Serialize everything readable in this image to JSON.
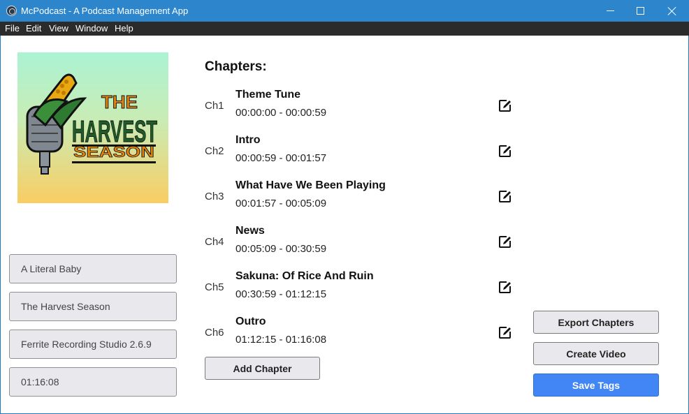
{
  "window": {
    "title": "McPodcast - A Podcast Management App"
  },
  "menu": [
    "File",
    "Edit",
    "View",
    "Window",
    "Help"
  ],
  "cover": {
    "line1": "THE",
    "line2": "HARVEST",
    "line3": "SEASON"
  },
  "metadata": {
    "artist": "A Literal Baby",
    "album": "The Harvest Season",
    "encoder": "Ferrite Recording Studio 2.6.9",
    "duration": "01:16:08"
  },
  "chapters": {
    "heading": "Chapters:",
    "items": [
      {
        "num": "Ch1",
        "title": "Theme Tune",
        "time": "00:00:00 - 00:00:59"
      },
      {
        "num": "Ch2",
        "title": "Intro",
        "time": "00:00:59 - 00:01:57"
      },
      {
        "num": "Ch3",
        "title": "What Have We Been Playing",
        "time": "00:01:57 - 00:05:09"
      },
      {
        "num": "Ch4",
        "title": "News",
        "time": "00:05:09 - 00:30:59"
      },
      {
        "num": "Ch5",
        "title": "Sakuna: Of Rice And Ruin",
        "time": "00:30:59 - 01:12:15"
      },
      {
        "num": "Ch6",
        "title": "Outro",
        "time": "01:12:15 - 01:16:08"
      }
    ]
  },
  "buttons": {
    "add_chapter": "Add Chapter",
    "export_chapters": "Export Chapters",
    "create_video": "Create Video",
    "save_tags": "Save Tags"
  },
  "icons": {
    "edit": "edit-icon",
    "app": "app-icon",
    "minimize": "minimize-icon",
    "maximize": "maximize-icon",
    "close": "close-icon"
  },
  "colors": {
    "titlebar": "#2d86cc",
    "menubar": "#2b2b2b",
    "primary_button": "#4285f4",
    "cover_orange": "#e8880c",
    "cover_green": "#1f5c2a"
  }
}
